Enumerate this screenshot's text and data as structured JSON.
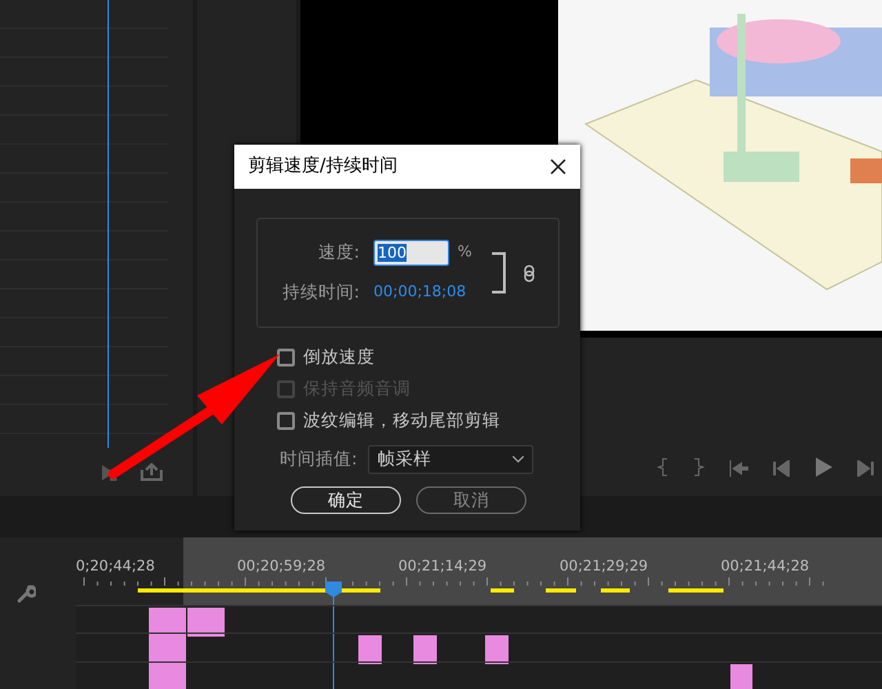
{
  "dialog": {
    "title": "剪辑速度/持续时间",
    "speed_label": "速度:",
    "speed_value": "100",
    "speed_unit": "%",
    "duration_label": "持续时间:",
    "duration_value": "00;00;18;08",
    "options": [
      {
        "label": "倒放速度",
        "checked": false,
        "disabled": false
      },
      {
        "label": "保持音频音调",
        "checked": false,
        "disabled": true
      },
      {
        "label": "波纹编辑，移动尾部剪辑",
        "checked": false,
        "disabled": false
      }
    ],
    "interp_label": "时间插值:",
    "interp_value": "帧采样",
    "buttons": [
      {
        "label": "确定",
        "kind": "primary"
      },
      {
        "label": "取消",
        "kind": "secondary"
      }
    ]
  },
  "timeline": {
    "timecodes": [
      "0;20;44;28",
      "00;20;59;28",
      "00;21;14;29",
      "00;21;29;29",
      "00;21;44;28"
    ]
  }
}
